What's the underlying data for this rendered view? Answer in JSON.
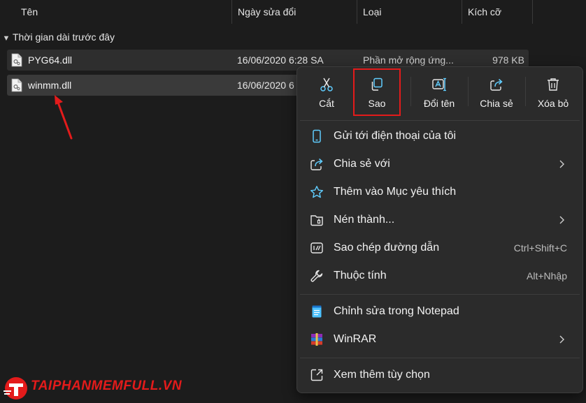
{
  "columns": {
    "name": "Tên",
    "modified": "Ngày sửa đổi",
    "type": "Loại",
    "size": "Kích cỡ"
  },
  "group": {
    "label": "Thời gian dài trước đây"
  },
  "files": [
    {
      "name": "PYG64.dll",
      "date": "16/06/2020 6:28 SA",
      "type": "Phần mở rộng ứng...",
      "size": "978 KB"
    },
    {
      "name": "winmm.dll",
      "date": "16/06/2020 6"
    }
  ],
  "context_menu": {
    "toolbar": [
      {
        "id": "cut",
        "label": "Cắt",
        "icon": "scissors-icon"
      },
      {
        "id": "copy",
        "label": "Sao",
        "icon": "copy-icon",
        "highlighted": true
      },
      {
        "id": "rename",
        "label": "Đổi tên",
        "icon": "rename-icon"
      },
      {
        "id": "share",
        "label": "Chia sẻ",
        "icon": "share-icon"
      },
      {
        "id": "delete",
        "label": "Xóa bỏ",
        "icon": "trash-icon"
      }
    ],
    "items": [
      {
        "label": "Gửi tới điện thoại của tôi",
        "icon": "phone-icon"
      },
      {
        "label": "Chia sẻ với",
        "icon": "share-icon",
        "submenu": true
      },
      {
        "label": "Thêm vào Mục yêu thích",
        "icon": "star-icon"
      },
      {
        "label": "Nén thành...",
        "icon": "zip-folder-icon",
        "submenu": true
      },
      {
        "label": "Sao chép đường dẫn",
        "icon": "copy-path-icon",
        "shortcut": "Ctrl+Shift+C"
      },
      {
        "label": "Thuộc tính",
        "icon": "wrench-icon",
        "shortcut": "Alt+Nhập"
      },
      {
        "label": "Chỉnh sửa trong Notepad",
        "icon": "notepad-icon"
      },
      {
        "label": "WinRAR",
        "icon": "winrar-icon",
        "submenu": true
      },
      {
        "label": "Xem thêm tùy chọn",
        "icon": "more-options-icon"
      }
    ]
  },
  "watermark": {
    "brand": "TAIPHANMEMFULL.VN"
  },
  "colors": {
    "background": "#1c1c1c",
    "menu": "#2b2b2b",
    "accent": "#60cdff",
    "highlight": "#e31b1b"
  }
}
